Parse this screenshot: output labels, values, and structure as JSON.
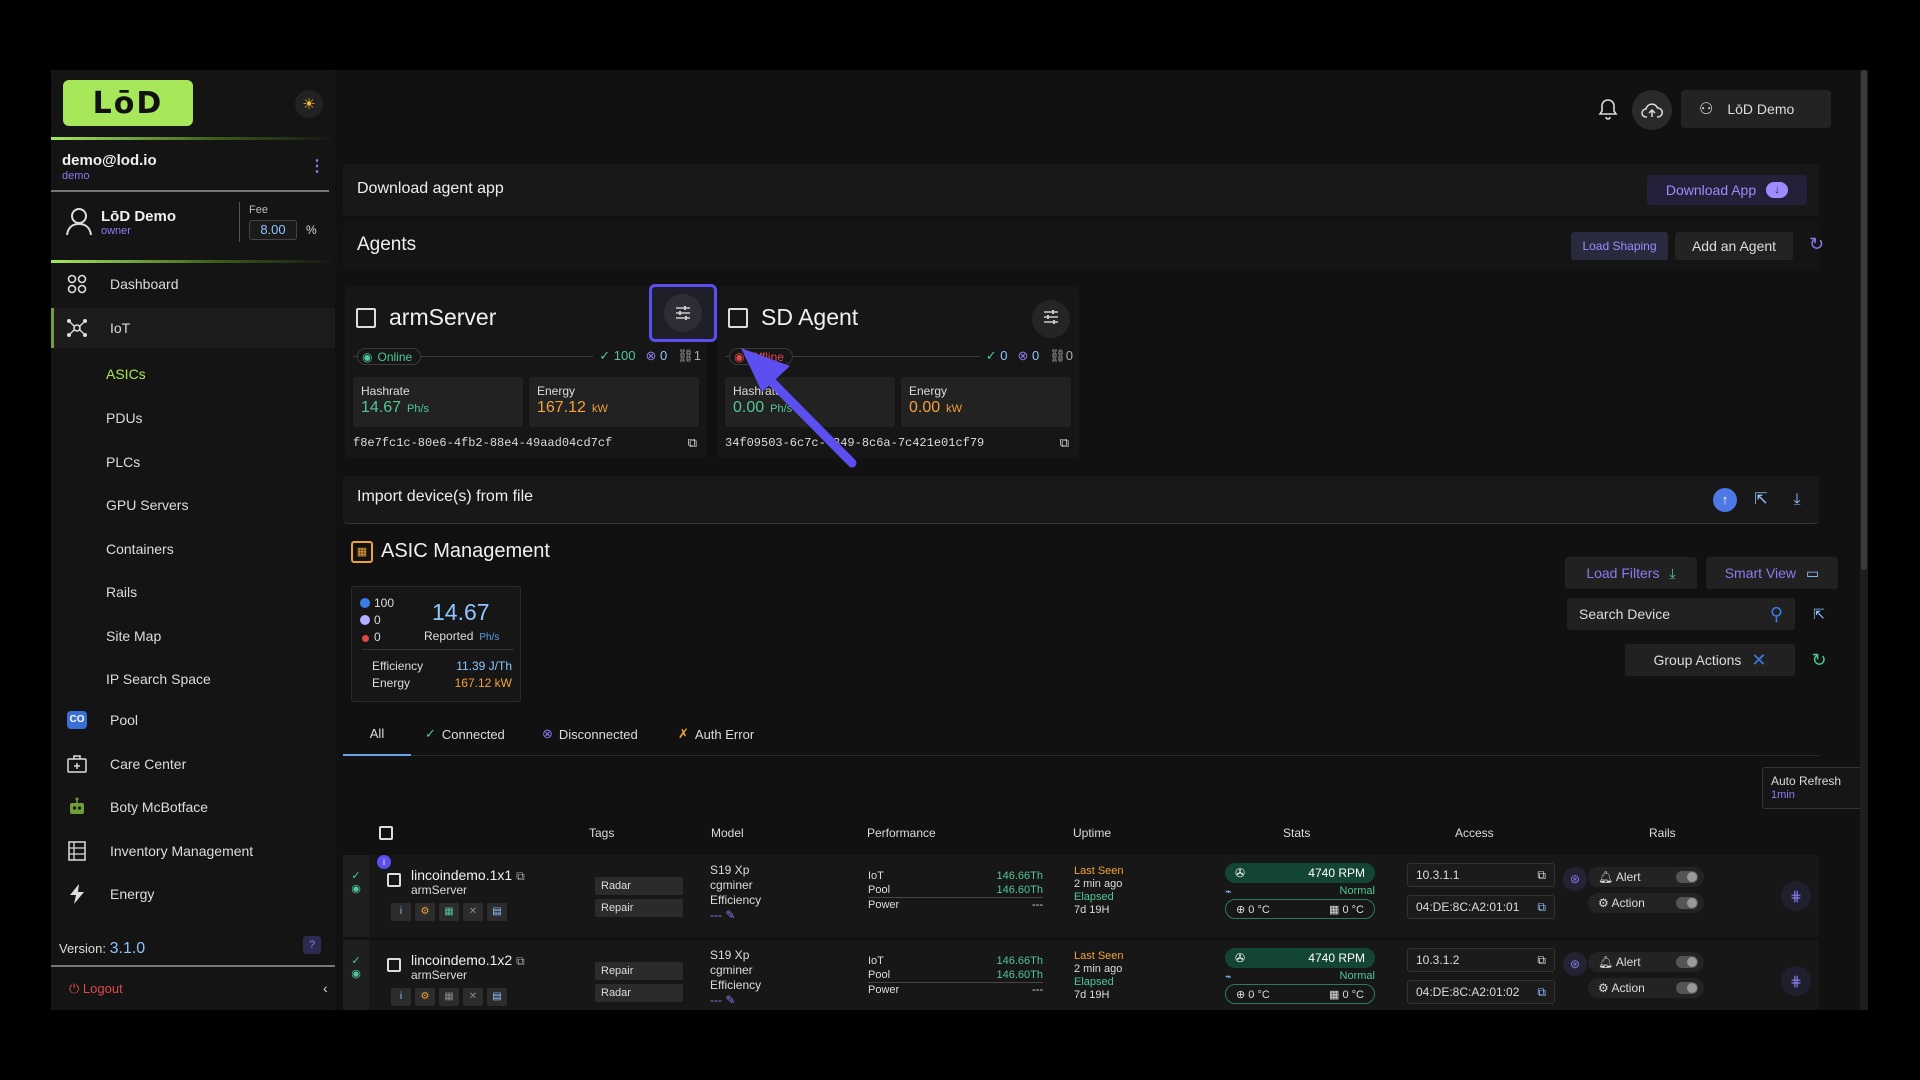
{
  "sidebar": {
    "logo": "LōD",
    "account": {
      "email": "demo@lod.io",
      "role": "demo"
    },
    "user": {
      "name": "LōD Demo",
      "role": "owner"
    },
    "fee": {
      "label": "Fee",
      "value": "8.00",
      "unit": "%"
    },
    "nav": [
      {
        "label": "Dashboard",
        "icon": "grid-icon"
      },
      {
        "label": "IoT",
        "icon": "network-icon"
      },
      {
        "label": "Pool",
        "icon": "pool-icon"
      },
      {
        "label": "Care Center",
        "icon": "medical-case-icon"
      },
      {
        "label": "Boty McBotface",
        "icon": "robot-icon"
      },
      {
        "label": "Inventory Management",
        "icon": "inventory-icon"
      },
      {
        "label": "Energy",
        "icon": "lightning-icon"
      }
    ],
    "iot_sub": [
      "ASICs",
      "PDUs",
      "PLCs",
      "GPU Servers",
      "Containers",
      "Rails",
      "Site Map",
      "IP Search Space"
    ],
    "version_label": "Version:",
    "version": "3.1.0",
    "logout": "Logout"
  },
  "header": {
    "user_button": "LōD Demo"
  },
  "download": {
    "text": "Download agent app",
    "button": "Download App"
  },
  "agents": {
    "title": "Agents",
    "load_shaping": "Load Shaping",
    "add": "Add an Agent",
    "cards": [
      {
        "name": "armServer",
        "status": "Online",
        "ok": "100",
        "err": "0",
        "links": "1",
        "hashrate_label": "Hashrate",
        "hashrate": "14.67",
        "hashrate_unit": "Ph/s",
        "energy_label": "Energy",
        "energy": "167.12",
        "energy_unit": "kW",
        "uuid": "f8e7fc1c-80e6-4fb2-88e4-49aad04cd7cf"
      },
      {
        "name": "SD Agent",
        "status": "Offline",
        "ok": "0",
        "err": "0",
        "links": "0",
        "hashrate_label": "Hashrate",
        "hashrate": "0.00",
        "hashrate_unit": "Ph/s",
        "energy_label": "Energy",
        "energy": "0.00",
        "energy_unit": "kW",
        "uuid": "34f09503-6c7c-4349-8c6a-7c421e01cf79"
      }
    ]
  },
  "import": {
    "title": "Import device(s) from file"
  },
  "asic": {
    "title": "ASIC Management",
    "counts": [
      "100",
      "0",
      "0"
    ],
    "reported_value": "14.67",
    "reported_label": "Reported",
    "reported_unit": "Ph/s",
    "efficiency_label": "Efficiency",
    "efficiency": "11.39 J/Th",
    "energy_label": "Energy",
    "energy": "167.12 kW",
    "load_filters": "Load Filters",
    "smart_view": "Smart View",
    "search_placeholder": "Search Device",
    "group_actions": "Group Actions"
  },
  "tabs": [
    "All",
    "Connected",
    "Disconnected",
    "Auth Error"
  ],
  "auto_refresh": {
    "label": "Auto Refresh",
    "value": "1min"
  },
  "table": {
    "headers": [
      "Tags",
      "Model",
      "Performance",
      "Uptime",
      "Stats",
      "Access",
      "Rails"
    ],
    "rows": [
      {
        "name": "lincoindemo.1x1",
        "server": "armServer",
        "tags": [
          "Radar",
          "Repair"
        ],
        "model": "S19 Xp",
        "firmware": "cgminer",
        "eff_label": "Efficiency",
        "eff": "---",
        "perf": [
          [
            "IoT",
            "146.66Th"
          ],
          [
            "Pool",
            "146.60Th"
          ],
          [
            "Power",
            "---"
          ]
        ],
        "last_seen_label": "Last Seen",
        "last_seen": "2 min ago",
        "elapsed_label": "Elapsed",
        "elapsed": "7d 19H",
        "rpm": "4740 RPM",
        "fan_state": "Normal",
        "temp1": "0 °C",
        "temp2": "0 °C",
        "ip": "10.3.1.1",
        "mac": "04:DE:8C:A2:01:01",
        "alert": "Alert",
        "action": "Action"
      },
      {
        "name": "lincoindemo.1x2",
        "server": "armServer",
        "tags": [
          "Repair",
          "Radar"
        ],
        "model": "S19 Xp",
        "firmware": "cgminer",
        "eff_label": "Efficiency",
        "eff": "---",
        "perf": [
          [
            "IoT",
            "146.66Th"
          ],
          [
            "Pool",
            "146.60Th"
          ],
          [
            "Power",
            "---"
          ]
        ],
        "last_seen_label": "Last Seen",
        "last_seen": "2 min ago",
        "elapsed_label": "Elapsed",
        "elapsed": "7d 19H",
        "rpm": "4740 RPM",
        "fan_state": "Normal",
        "temp1": "0 °C",
        "temp2": "0 °C",
        "ip": "10.3.1.2",
        "mac": "04:DE:8C:A2:01:02",
        "alert": "Alert",
        "action": "Action"
      }
    ]
  },
  "colors": {
    "accent_green": "#a6e85a",
    "purple": "#5b4ff0",
    "online": "#4fc796",
    "offline": "#e04848",
    "energy": "#f2a23a"
  }
}
